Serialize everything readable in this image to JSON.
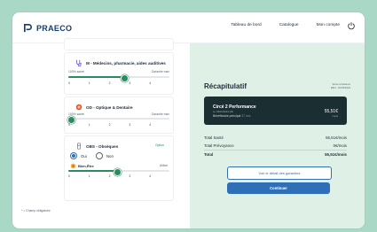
{
  "brand": {
    "name": "PRAECO",
    "color": "#173d6b"
  },
  "nav": {
    "items": [
      "Tableau de bord",
      "Catalogue",
      "Mon compte"
    ]
  },
  "colors": {
    "accent": "#2f6fb7",
    "green": "#2b8a5f",
    "dark": "#1b2f32",
    "panel": "#dff1e6"
  },
  "options": [
    {
      "title": "M - Médecins, pharmacie, aides auditives",
      "icon": "stethoscope-icon",
      "left_label": "100% santé",
      "right_label": "Garantie max",
      "ticks": [
        "0",
        "1",
        "2",
        "3",
        "4"
      ],
      "level": 2
    },
    {
      "title": "OD - Optique & Dentaire",
      "icon": "tooth-icon",
      "left_label": "100% santé",
      "right_label": "Garantie max",
      "ticks": [
        "0",
        "1",
        "2",
        "3",
        "4"
      ],
      "level": 0
    },
    {
      "title": "OBS - Obsèques",
      "icon": "obseques-icon",
      "option_label": "Option",
      "radio": {
        "yes": "Oui",
        "no": "Non",
        "selected": "Oui"
      },
      "wellbeing": {
        "title": "Bien-Être",
        "right_label": "Utilisé",
        "ticks": [
          "0",
          "1",
          "2",
          "3",
          "4"
        ],
        "level": 2
      }
    }
  ],
  "footnote": "* = Champ obligatoire",
  "summary": {
    "title": "Récapitulatif",
    "note_line1": "Vente à distance",
    "note_line2": "Effet : 01/03/2024",
    "plan": {
      "name": "Circé 2 Performance",
      "subtitle": "Le 03/01/2024 (M)",
      "beneficiary_label": "Bénéficiaire principal",
      "beneficiary_age": "37 ans",
      "price": "55,51€",
      "period": "/mois"
    },
    "lines": [
      {
        "label": "Total Santé",
        "value": "55,51€/mois"
      },
      {
        "label": "Total Prévoyance",
        "value": "0€/mois"
      },
      {
        "label": "Total",
        "value": "55,51€/mois"
      }
    ],
    "details_button": "Voir le détail des garanties",
    "continue_button": "Continuer"
  }
}
